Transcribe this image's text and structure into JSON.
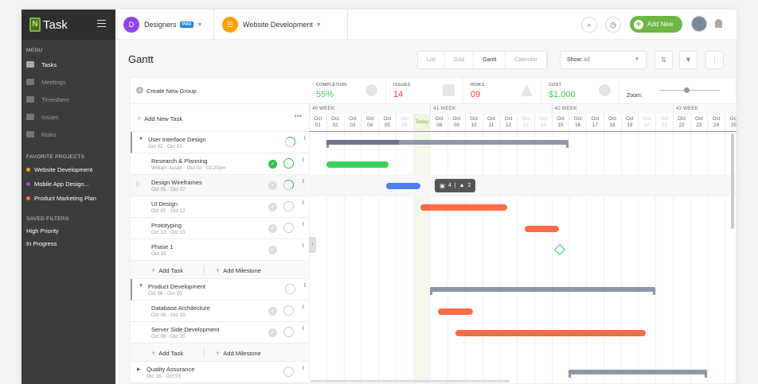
{
  "app": {
    "logo_text": "Task"
  },
  "sidebar": {
    "menu_title": "MENU",
    "items": [
      {
        "label": "Tasks",
        "active": true
      },
      {
        "label": "Meetings"
      },
      {
        "label": "Timesheet"
      },
      {
        "label": "Issues"
      },
      {
        "label": "Risks"
      }
    ],
    "favorites_title": "FAVORITE PROJECTS",
    "favorites": [
      {
        "label": "Website Development",
        "color": "#ff9800"
      },
      {
        "label": "Mobile App Design...",
        "color": "#9c4dcc"
      },
      {
        "label": "Product Marketing Plan",
        "color": "#ff6d2e"
      }
    ],
    "filters_title": "SAVED FILTERS",
    "filters": [
      {
        "label": "High Priority"
      },
      {
        "label": "In Progress"
      }
    ]
  },
  "topbar": {
    "workspace_initial": "D",
    "workspace": "Designers",
    "badge": "PRO",
    "project": "Website Development",
    "add_new": "Add New"
  },
  "page": {
    "title": "Gantt",
    "views": [
      "List",
      "Grid",
      "Gantt",
      "Calendar"
    ],
    "active_view": "Gantt",
    "show_label": "Show:",
    "show_value": "All"
  },
  "stats": {
    "create_group": "Create New Group",
    "completion_label": "COMPLETION",
    "completion": "55%",
    "issues_label": "ISSUES",
    "issues": "14",
    "risks_label": "RISKS",
    "risks": "09",
    "cost_label": "COST",
    "cost": "$1.000",
    "zoom_label": "Zoom:",
    "zoom_level": 0.45
  },
  "list": {
    "add_new_task": "Add New Task",
    "add_task": "Add Task",
    "add_milestone": "Add Milestone"
  },
  "timeline": {
    "weeks": [
      {
        "label": "40 WEEK",
        "start": 1
      },
      {
        "label": "41 WEEK",
        "start": 8
      },
      {
        "label": "42 WEEK",
        "start": 15
      },
      {
        "label": "43 WEEK",
        "start": 22
      }
    ],
    "month": "Oct",
    "days": [
      "01",
      "02",
      "03",
      "04",
      "05",
      "06",
      "Today",
      "08",
      "09",
      "10",
      "11",
      "12",
      "13",
      "14",
      "15",
      "16",
      "17",
      "18",
      "19",
      "20",
      "21",
      "22",
      "23",
      "24",
      "25"
    ],
    "weekend": [
      6,
      13,
      14,
      20,
      21
    ],
    "today": 7
  },
  "rows": [
    {
      "type": "group",
      "name": "User Interface Design",
      "sub": "Oct 02 - Oct 15",
      "start": 2,
      "end": 15,
      "progress": 0.3
    },
    {
      "type": "task",
      "name": "Research & Planning",
      "sub": "William Austin · Oct 02 · 03:20pm",
      "start": 2,
      "end": 5,
      "color": "#3ccf5f",
      "done": true,
      "progress": 1
    },
    {
      "type": "task",
      "name": "Design Wireframes",
      "sub": "Oct 05 - Oct 07",
      "start": 5,
      "end": 7,
      "color": "#4a7ff5",
      "progress": 0.5,
      "badges": {
        "subtasks": "4",
        "risks": "2"
      }
    },
    {
      "type": "task",
      "name": "UI Design",
      "sub": "Oct 07 - Oct 12",
      "start": 7,
      "end": 12,
      "color": "#ff6b47",
      "progress": 0
    },
    {
      "type": "task",
      "name": "Prototyping",
      "sub": "Oct 13 - Oct 15",
      "start": 13,
      "end": 15,
      "color": "#ff6b47",
      "progress": 0
    },
    {
      "type": "milestone",
      "name": "Phase 1",
      "sub": "Oct 15",
      "start": 15,
      "color": "#3ccf5f"
    },
    {
      "type": "add"
    },
    {
      "type": "group",
      "name": "Product Development",
      "sub": "Oct 08 - Oct 20",
      "start": 8,
      "end": 20,
      "progress": 0
    },
    {
      "type": "task",
      "name": "Database Architecture",
      "sub": "Oct 08 - Oct 10",
      "start": 8,
      "end": 10,
      "color": "#ff6b47",
      "progress": 0
    },
    {
      "type": "task",
      "name": "Server Side Development",
      "sub": "Oct 09 - Oct 20",
      "start": 9,
      "end": 20,
      "color": "#ff6b47",
      "progress": 0
    },
    {
      "type": "add"
    },
    {
      "type": "group",
      "name": "Quality Assurance",
      "sub": "Oct 16 - Oct 23",
      "start": 16,
      "end": 23,
      "progress": 0,
      "collapsed": true
    }
  ]
}
